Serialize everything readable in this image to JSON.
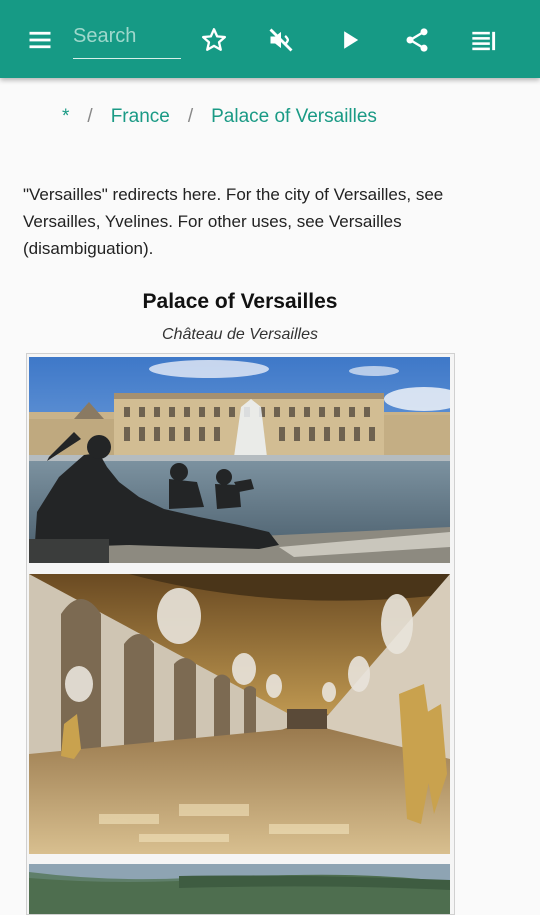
{
  "toolbar": {
    "search_placeholder": "Search",
    "icons": [
      "menu-icon",
      "star-icon",
      "volume-off-icon",
      "play-icon",
      "share-icon",
      "list-icon"
    ]
  },
  "breadcrumb": {
    "home": "*",
    "separator": "/",
    "items": [
      {
        "label": "France"
      },
      {
        "label": "Palace of Versailles"
      }
    ]
  },
  "article": {
    "hatnote": "\"Versailles\" redirects here. For the city of Versailles, see Versailles, Yvelines. For other uses, see Versailles (disambiguation)."
  },
  "infobox": {
    "title": "Palace of Versailles",
    "subtitle": "Château de Versailles"
  },
  "colors": {
    "accent": "#169a85",
    "link": "#1a9a85",
    "background": "#fafafa"
  }
}
